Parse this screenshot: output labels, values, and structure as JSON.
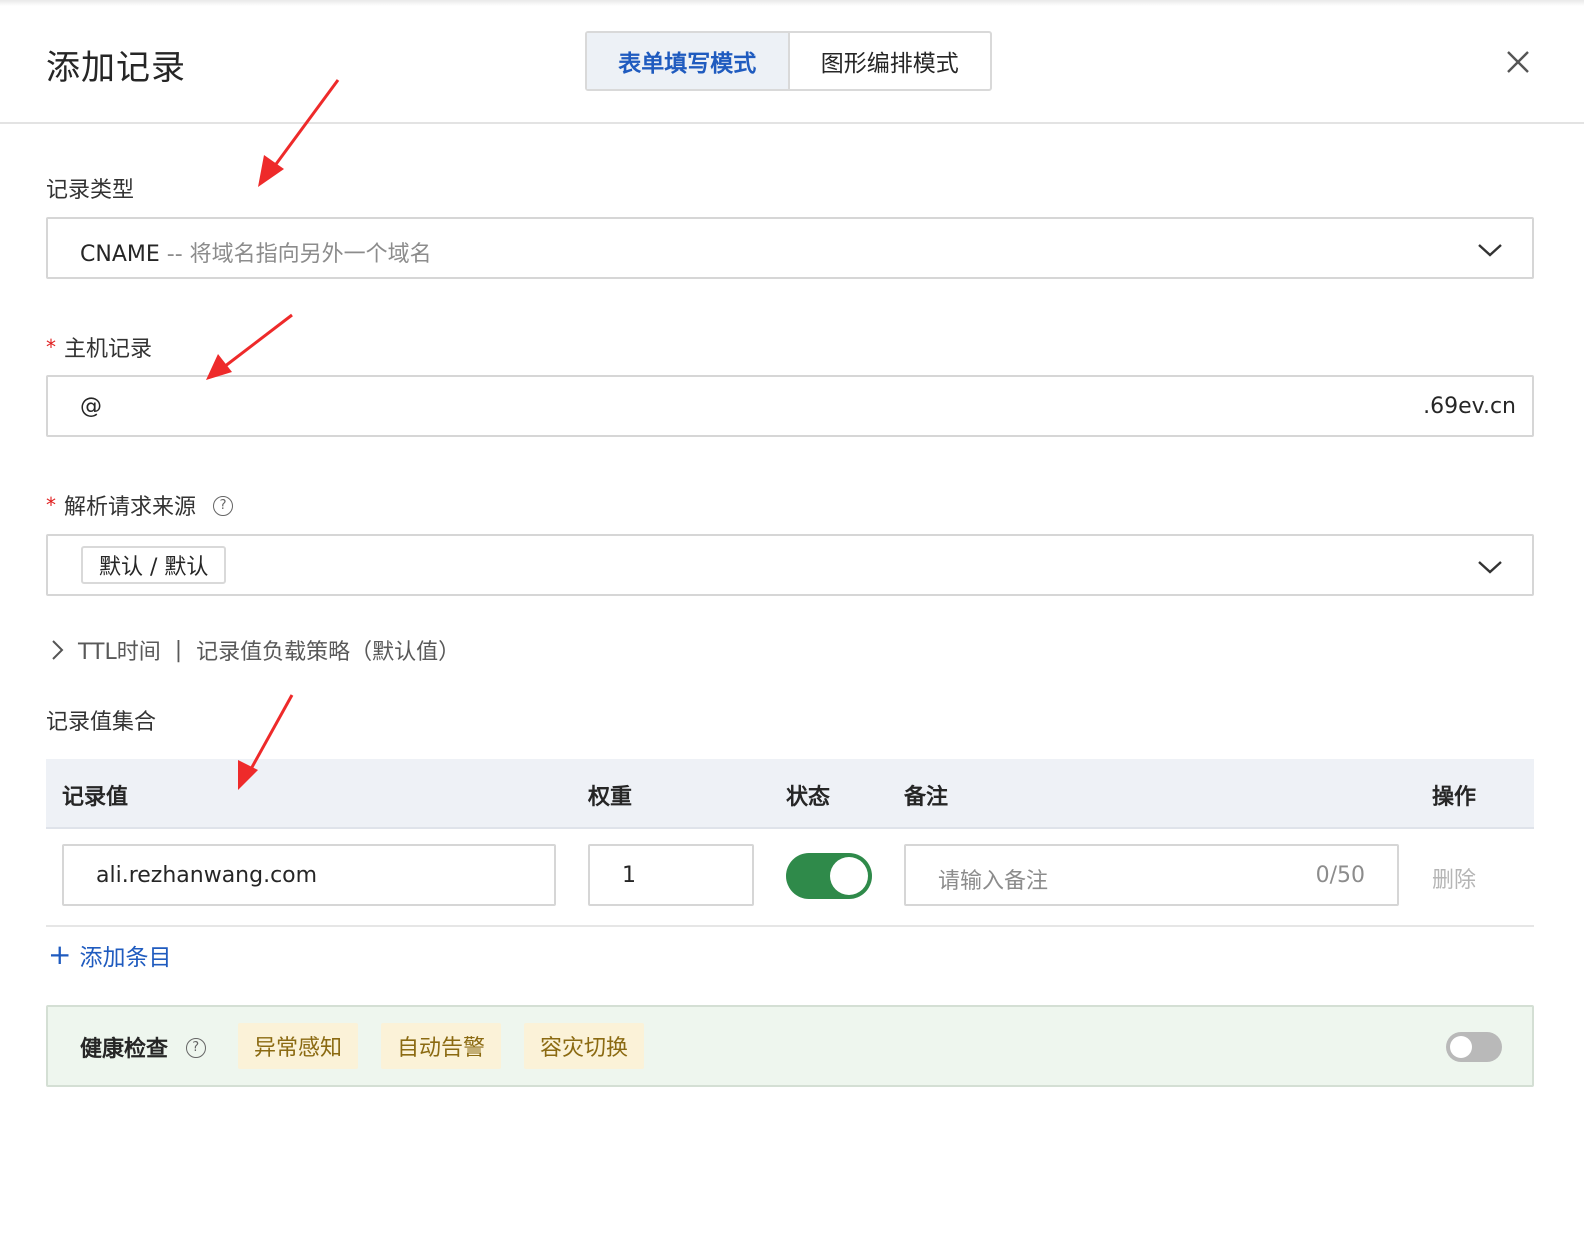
{
  "dialog": {
    "title": "添加记录",
    "tabs": [
      {
        "label": "表单填写模式",
        "active": true
      },
      {
        "label": "图形编排模式",
        "active": false
      }
    ],
    "close_icon": "close-icon"
  },
  "record_type": {
    "label": "记录类型",
    "value": "CNAME",
    "description": "-- 将域名指向另外一个域名"
  },
  "host_record": {
    "required_mark": "*",
    "label": "主机记录",
    "value": "@",
    "suffix": ".69ev.cn"
  },
  "resolve_source": {
    "required_mark": "*",
    "label": "解析请求来源",
    "help_icon": "question-circle-icon",
    "selected_tag": "默认 / 默认"
  },
  "advanced": {
    "ttl_label": "TTL时间",
    "separator": "|",
    "strategy_label": "记录值负载策略（默认值）"
  },
  "record_values": {
    "section_title": "记录值集合",
    "columns": [
      "记录值",
      "权重",
      "状态",
      "备注",
      "操作"
    ],
    "rows": [
      {
        "value": "ali.rezhanwang.com",
        "weight": "1",
        "enabled": true,
        "remark_placeholder": "请输入备注",
        "remark_count": "0/50",
        "action": "删除"
      }
    ],
    "add_label": "添加条目"
  },
  "health_check": {
    "title": "健康检查",
    "help_icon": "question-circle-icon",
    "tags": [
      "异常感知",
      "自动告警",
      "容灾切换"
    ],
    "enabled": false
  },
  "colors": {
    "accent_blue": "#1f5bbf",
    "toggle_green": "#2f8a4a",
    "annotation_red": "#ee2a2a",
    "health_bg": "#eef6ee",
    "tag_bg": "#fbf2d8"
  }
}
